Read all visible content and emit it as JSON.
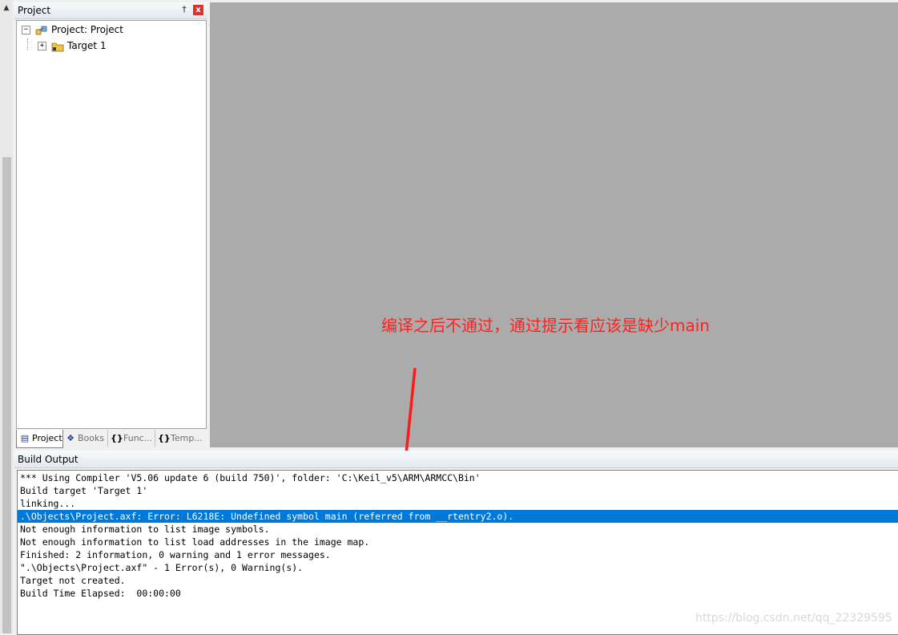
{
  "project_panel": {
    "title": "Project",
    "pin_glyph": "†",
    "close_glyph": "x",
    "tree": [
      {
        "label": "Project: Project",
        "expander": "−",
        "icon": "project-icon"
      },
      {
        "label": "Target 1",
        "expander": "+",
        "icon": "target-folder-icon"
      }
    ],
    "tabs": [
      {
        "label": "Project",
        "glyph": "▤",
        "icon": "project-tab-icon"
      },
      {
        "label": "Books",
        "glyph": "❖",
        "icon": "books-icon"
      },
      {
        "label": "Func...",
        "glyph": "{}",
        "icon": "functions-icon"
      },
      {
        "label": "Temp...",
        "glyph": "{}",
        "icon": "templates-icon"
      }
    ]
  },
  "annotation": {
    "text": "编译之后不通过，通过提示看应该是缺少main",
    "color": "#ff2020"
  },
  "build_output": {
    "title": "Build Output",
    "lines": [
      "*** Using Compiler 'V5.06 update 6 (build 750)', folder: 'C:\\Keil_v5\\ARM\\ARMCC\\Bin'",
      "Build target 'Target 1'",
      "linking...",
      ".\\Objects\\Project.axf: Error: L6218E: Undefined symbol main (referred from __rtentry2.o).",
      "Not enough information to list image symbols.",
      "Not enough information to list load addresses in the image map.",
      "Finished: 2 information, 0 warning and 1 error messages.",
      "\".\\Objects\\Project.axf\" - 1 Error(s), 0 Warning(s).",
      "Target not created.",
      "Build Time Elapsed:  00:00:00"
    ],
    "selected_index": 3,
    "selection_color": "#0078d7"
  },
  "watermark": "https://blog.csdn.net/qq_22329595"
}
